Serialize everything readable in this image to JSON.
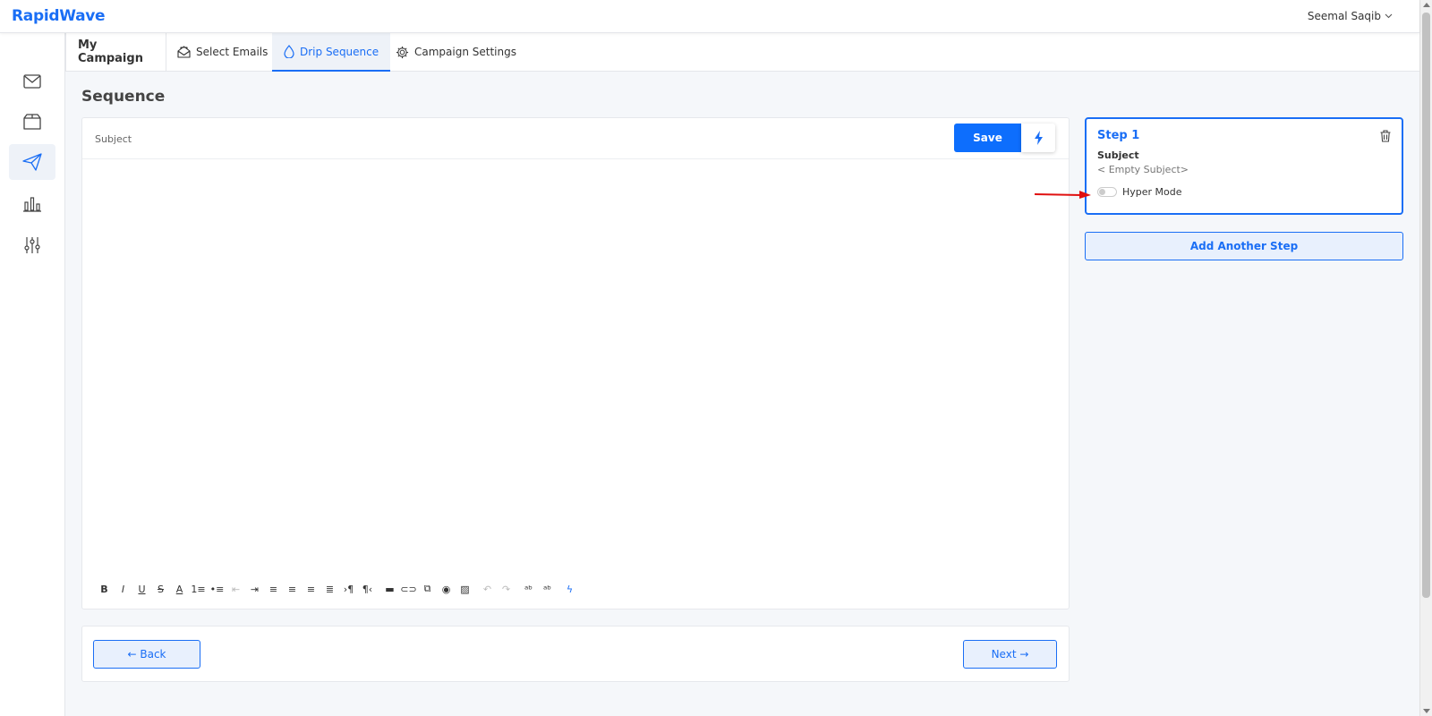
{
  "app": {
    "logo": "RapidWave",
    "user_name": "Seemal Saqib"
  },
  "sidebar": {
    "items": [
      {
        "icon": "envelope-icon",
        "active": false
      },
      {
        "icon": "box-icon",
        "active": false
      },
      {
        "icon": "paper-plane-icon",
        "active": true
      },
      {
        "icon": "bar-chart-icon",
        "active": false
      },
      {
        "icon": "sliders-icon",
        "active": false
      }
    ]
  },
  "tabs": [
    {
      "label": "My Campaign",
      "icon": "",
      "active": false
    },
    {
      "label": "Select Emails",
      "icon": "envelope-open-icon",
      "active": false
    },
    {
      "label": "Drip Sequence",
      "icon": "drop-icon",
      "active": true
    },
    {
      "label": "Campaign Settings",
      "icon": "gear-icon",
      "active": false
    }
  ],
  "page": {
    "title": "Sequence"
  },
  "editor": {
    "subject_placeholder": "Subject",
    "subject_value": "",
    "save_label": "Save",
    "toolbar": [
      {
        "name": "bold",
        "glyph": "B"
      },
      {
        "name": "italic",
        "glyph": "I"
      },
      {
        "name": "underline",
        "glyph": "U"
      },
      {
        "name": "strikethrough",
        "glyph": "S"
      },
      {
        "name": "font-color",
        "glyph": "A"
      },
      {
        "name": "ordered-list",
        "glyph": "1≡"
      },
      {
        "name": "unordered-list",
        "glyph": "•≡"
      },
      {
        "name": "outdent",
        "glyph": "⇤"
      },
      {
        "name": "indent",
        "glyph": "⇥"
      },
      {
        "name": "align-left",
        "glyph": "≡"
      },
      {
        "name": "align-center",
        "glyph": "≡"
      },
      {
        "name": "align-right",
        "glyph": "≡"
      },
      {
        "name": "justify",
        "glyph": "≣"
      },
      {
        "name": "ltr",
        "glyph": "›¶"
      },
      {
        "name": "rtl",
        "glyph": "¶‹"
      },
      {
        "name": "horizontal-rule",
        "glyph": "▬"
      },
      {
        "name": "link",
        "glyph": "⊂⊃"
      },
      {
        "name": "code",
        "glyph": "⧉"
      },
      {
        "name": "preview",
        "glyph": "◉"
      },
      {
        "name": "image",
        "glyph": "▨"
      },
      {
        "name": "undo",
        "glyph": "↶"
      },
      {
        "name": "redo",
        "glyph": "↷"
      },
      {
        "name": "spellcheck",
        "glyph": "ᵃᵇ"
      },
      {
        "name": "spellcheck-settings",
        "glyph": "ᵃᵇ"
      },
      {
        "name": "lightning",
        "glyph": "ϟ"
      }
    ]
  },
  "navigation": {
    "back_label": "← Back",
    "next_label": "Next →"
  },
  "steps": [
    {
      "title": "Step 1",
      "subject_label": "Subject",
      "subject_value": "< Empty Subject>",
      "hyper_mode_label": "Hyper Mode",
      "hyper_mode_on": false
    }
  ],
  "add_step_label": "Add Another Step",
  "colors": {
    "accent": "#1a6ef5",
    "save_button": "#0d6efd",
    "annotation_arrow": "#e01010"
  }
}
